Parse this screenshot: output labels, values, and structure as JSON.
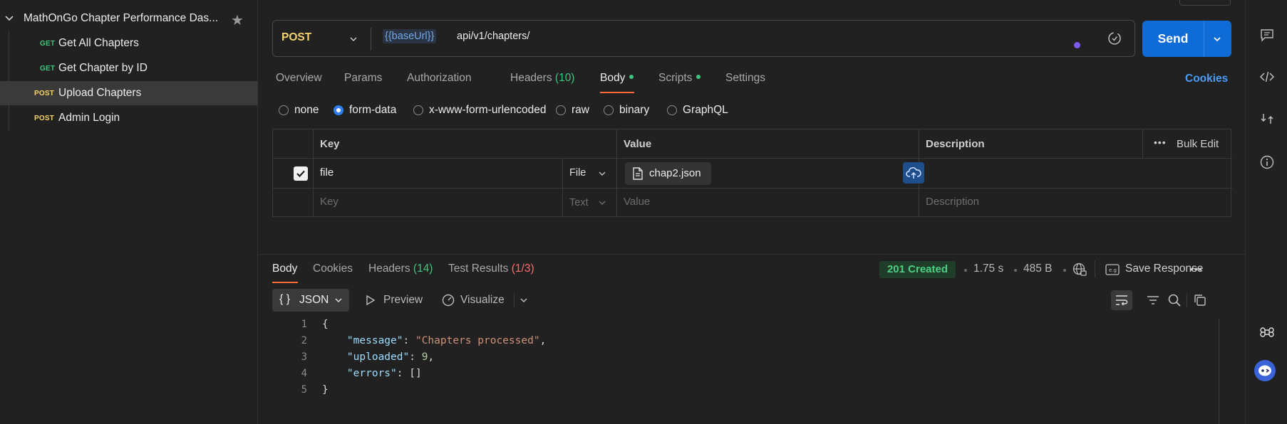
{
  "sidebar": {
    "collection_name": "MathOnGo Chapter Performance Das...",
    "requests": [
      {
        "method": "GET",
        "label": "Get All Chapters",
        "color": "#3ec57d",
        "active": false
      },
      {
        "method": "GET",
        "label": "Get Chapter by ID",
        "color": "#3ec57d",
        "active": false
      },
      {
        "method": "POST",
        "label": "Upload Chapters",
        "color": "#f5d36b",
        "active": true
      },
      {
        "method": "POST",
        "label": "Admin Login",
        "color": "#f5d36b",
        "active": false
      }
    ]
  },
  "request": {
    "method": "POST",
    "url_variable": "{{baseUrl}}",
    "url_path": "api/v1/chapters/",
    "send_label": "Send",
    "tabs": [
      {
        "label": "Overview"
      },
      {
        "label": "Params"
      },
      {
        "label": "Authorization"
      },
      {
        "label": "Headers",
        "count": "(10)"
      },
      {
        "label": "Body",
        "active": true
      },
      {
        "label": "Scripts"
      },
      {
        "label": "Settings"
      }
    ],
    "cookies_link": "Cookies",
    "body_modes": [
      "none",
      "form-data",
      "x-www-form-urlencoded",
      "raw",
      "binary",
      "GraphQL"
    ],
    "selected_body_mode": "form-data"
  },
  "form_table": {
    "headers": {
      "key": "Key",
      "value": "Value",
      "description": "Description",
      "bulk_edit": "Bulk Edit"
    },
    "rows": [
      {
        "checked": true,
        "key": "file",
        "type": "File",
        "value": "chap2.json",
        "description": ""
      }
    ],
    "empty_row": {
      "key_placeholder": "Key",
      "type": "Text",
      "value_placeholder": "Value",
      "description_placeholder": "Description"
    }
  },
  "response": {
    "tabs": [
      {
        "label": "Body",
        "active": true
      },
      {
        "label": "Cookies"
      },
      {
        "label": "Headers",
        "count": "(14)"
      },
      {
        "label": "Test Results",
        "count": "(1/3)"
      }
    ],
    "status": "201 Created",
    "time": "1.75 s",
    "size": "485 B",
    "save_response": "Save Response",
    "format": "JSON",
    "format_braces": "{ }",
    "preview": "Preview",
    "visualize": "Visualize",
    "code_lines": [
      {
        "n": "1",
        "text": "{"
      },
      {
        "n": "2",
        "key": "\"message\"",
        "sep": ": ",
        "str": "\"Chapters processed\"",
        "tail": ","
      },
      {
        "n": "3",
        "key": "\"uploaded\"",
        "sep": ": ",
        "num": "9",
        "tail": ","
      },
      {
        "n": "4",
        "key": "\"errors\"",
        "sep": ": ",
        "plain": "[]"
      },
      {
        "n": "5",
        "text": "}"
      }
    ]
  },
  "colors": {
    "accent_send": "#0f6bd6",
    "tab_underline": "#ff6c37",
    "get_method": "#3ec57d",
    "post_method": "#f5d36b",
    "status_ok": "#4cd182"
  },
  "icons": {
    "collapse": "chevron-down-icon",
    "favorite": "star-icon",
    "url_extra": "environment-icon",
    "send_menu": "chevron-down-icon",
    "file": "file-icon",
    "upload": "cloud-upload-icon",
    "network": "globe-icon",
    "save": "save-icon",
    "more": "more-horizontal-icon"
  }
}
